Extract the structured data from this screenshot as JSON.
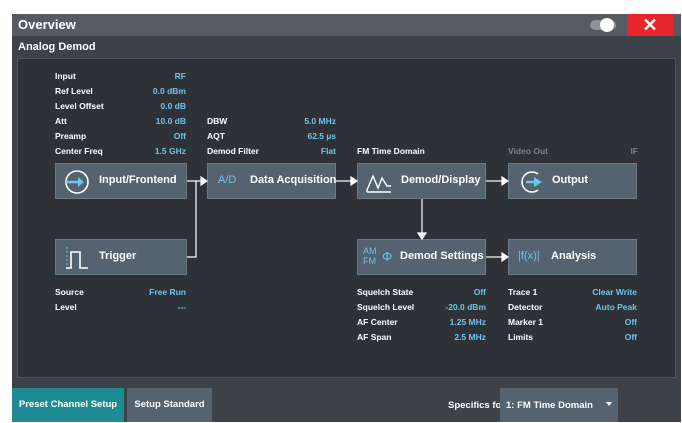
{
  "window": {
    "title": "Overview",
    "close_label": "✕"
  },
  "section": {
    "title": "Analog Demod"
  },
  "input_params": [
    {
      "label": "Input",
      "value": "RF"
    },
    {
      "label": "Ref Level",
      "value": "0.0 dBm"
    },
    {
      "label": "Level Offset",
      "value": "0.0 dB"
    },
    {
      "label": "Att",
      "value": "10.0 dB"
    },
    {
      "label": "Preamp",
      "value": "Off"
    },
    {
      "label": "Center Freq",
      "value": "1.5 GHz"
    }
  ],
  "acq_params": [
    {
      "label": "DBW",
      "value": "5.0 MHz"
    },
    {
      "label": "AQT",
      "value": "62.5 µs"
    },
    {
      "label": "Demod Filter",
      "value": "Flat"
    }
  ],
  "display_header": "FM Time Domain",
  "output_header": {
    "label": "Video Out",
    "value": "IF"
  },
  "blocks": {
    "input_frontend": "Input/Frontend",
    "data_acquisition": "Data Acquisition",
    "data_acquisition_icon": "A/D",
    "demod_display": "Demod/Display",
    "output": "Output",
    "trigger": "Trigger",
    "demod_settings": "Demod Settings",
    "demod_settings_icon_top": "AM",
    "demod_settings_icon_bottom": "FM",
    "demod_settings_icon_phi": "Φ",
    "analysis": "Analysis",
    "analysis_icon": "|f(x)|"
  },
  "trigger_params": [
    {
      "label": "Source",
      "value": "Free Run"
    },
    {
      "label": "Level",
      "value": "---"
    }
  ],
  "demod_params": [
    {
      "label": "Squelch State",
      "value": "Off"
    },
    {
      "label": "Squelch Level",
      "value": "-20.0 dBm"
    },
    {
      "label": "AF Center",
      "value": "1.25 MHz"
    },
    {
      "label": "AF Span",
      "value": "2.5 MHz"
    }
  ],
  "analysis_params": [
    {
      "label": "Trace 1",
      "value": "Clear Write"
    },
    {
      "label": "Detector",
      "value": "Auto Peak"
    },
    {
      "label": "Marker 1",
      "value": "Off"
    },
    {
      "label": "Limits",
      "value": "Off"
    }
  ],
  "bottom": {
    "preset_label": "Preset Channel Setup",
    "standard_label": "Setup Standard",
    "specifics_label": "Specifics for",
    "specifics_value": "1: FM Time Domain"
  },
  "colors": {
    "accent": "#6fc4e9",
    "teal": "#1d8b94",
    "close_red": "#e8262d",
    "block": "#55626f"
  }
}
